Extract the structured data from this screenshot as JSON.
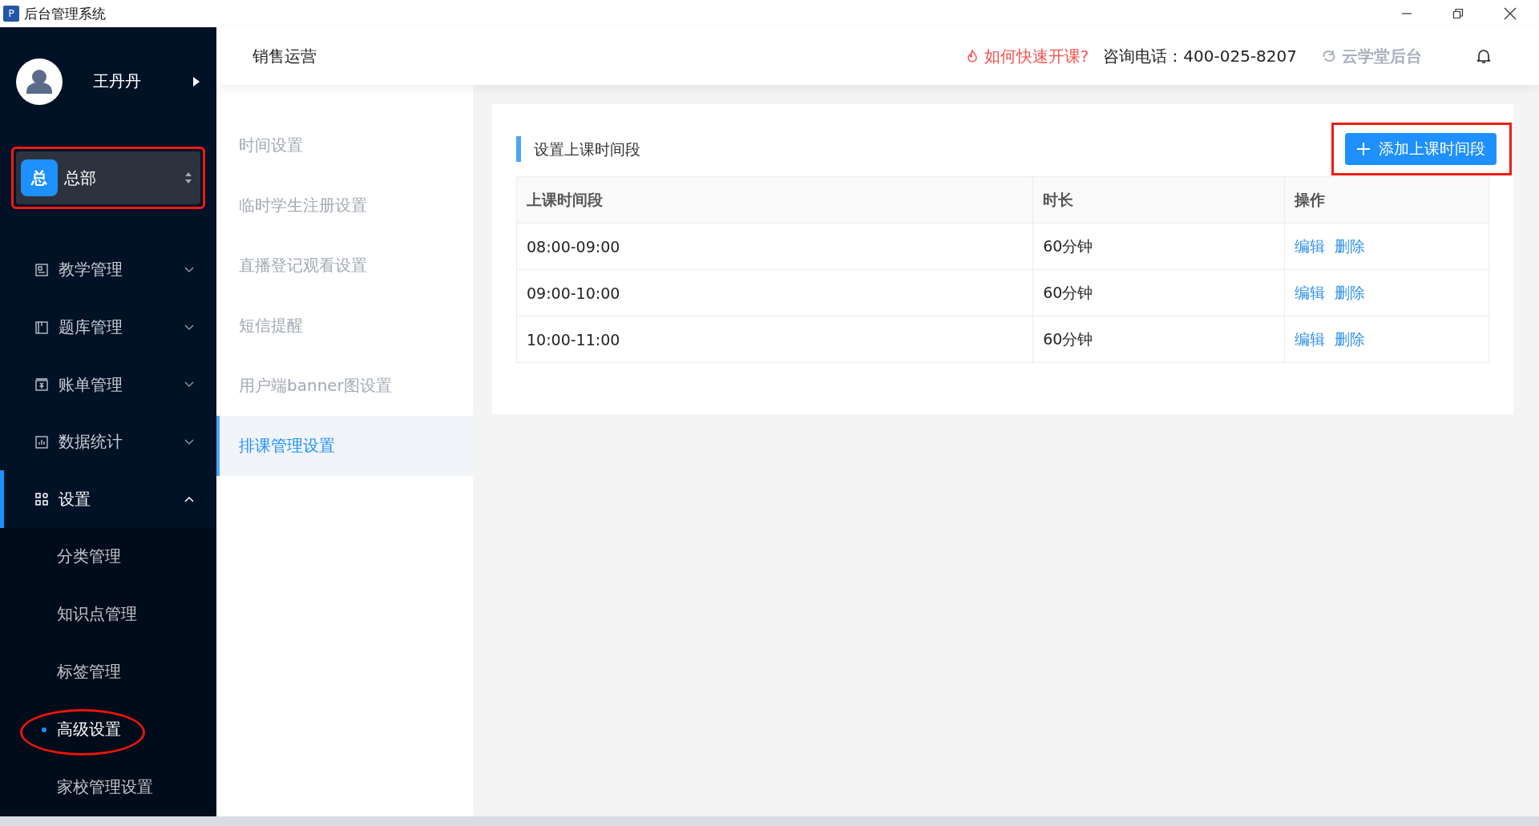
{
  "window": {
    "title": "后台管理系统",
    "app_icon": "P"
  },
  "user": {
    "name": "王丹丹"
  },
  "org": {
    "badge": "总",
    "name": "总部",
    "highlighted": true
  },
  "nav": [
    {
      "label": "教学管理",
      "expanded": false,
      "selected": false
    },
    {
      "label": "题库管理",
      "expanded": false,
      "selected": false
    },
    {
      "label": "账单管理",
      "expanded": false,
      "selected": false
    },
    {
      "label": "数据统计",
      "expanded": false,
      "selected": false
    },
    {
      "label": "设置",
      "expanded": true,
      "selected": true,
      "children": [
        {
          "label": "分类管理",
          "selected": false,
          "highlighted": false
        },
        {
          "label": "知识点管理",
          "selected": false,
          "highlighted": false
        },
        {
          "label": "标签管理",
          "selected": false,
          "highlighted": false
        },
        {
          "label": "高级设置",
          "selected": true,
          "highlighted": true
        },
        {
          "label": "家校管理设置",
          "selected": false,
          "highlighted": false
        }
      ]
    }
  ],
  "header": {
    "title": "销售运营",
    "help_link": "如何快速开课?",
    "phone": "咨询电话：400-025-8207",
    "brand": "云学堂后台"
  },
  "subnav": [
    {
      "label": "时间设置",
      "selected": false
    },
    {
      "label": "临时学生注册设置",
      "selected": false
    },
    {
      "label": "直播登记观看设置",
      "selected": false
    },
    {
      "label": "短信提醒",
      "selected": false
    },
    {
      "label": "用户端banner图设置",
      "selected": false
    },
    {
      "label": "排课管理设置",
      "selected": true
    }
  ],
  "panel": {
    "title": "设置上课时间段",
    "add_button": {
      "label": "添加上课时间段",
      "highlighted": true
    },
    "table": {
      "columns": [
        "上课时间段",
        "时长",
        "操作"
      ],
      "rows": [
        {
          "period": "08:00-09:00",
          "duration": "60分钟",
          "actions": [
            "编辑",
            "删除"
          ]
        },
        {
          "period": "09:00-10:00",
          "duration": "60分钟",
          "actions": [
            "编辑",
            "删除"
          ]
        },
        {
          "period": "10:00-11:00",
          "duration": "60分钟",
          "actions": [
            "编辑",
            "删除"
          ]
        }
      ]
    }
  }
}
